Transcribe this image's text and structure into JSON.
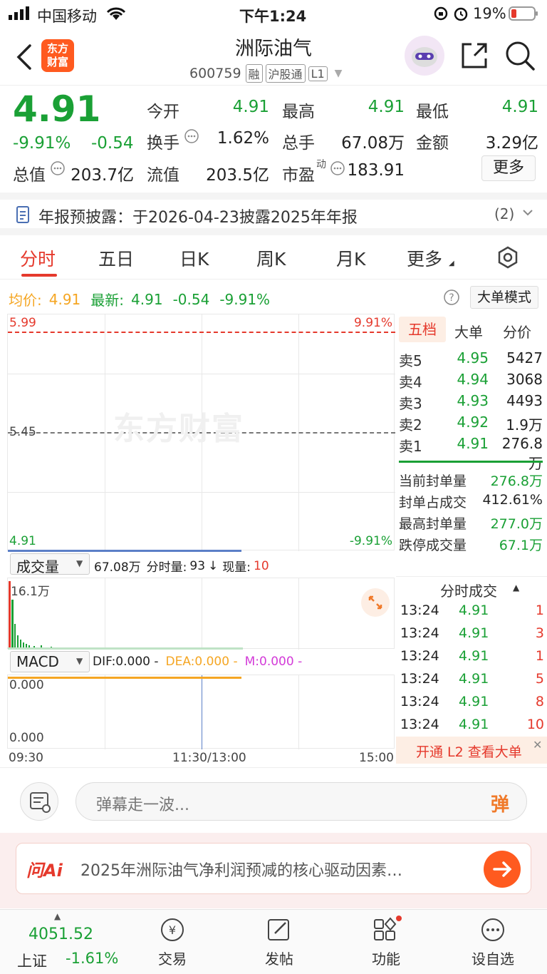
{
  "status_bar": {
    "carrier": "中国移动",
    "time": "下午1:24",
    "battery": "19%"
  },
  "header": {
    "logo_text_1": "东方",
    "logo_text_2": "财富",
    "stock_name": "洲际油气",
    "stock_code": "600759",
    "tags": [
      "融",
      "沪股通",
      "L1"
    ]
  },
  "quote": {
    "price": "4.91",
    "change_pct": "-9.91%",
    "change": "-0.54",
    "rows": [
      {
        "label": "今开",
        "value": "4.91",
        "label2": "最高",
        "value2": "4.91",
        "label3": "最低",
        "value3": "4.91"
      },
      {
        "label": "换手",
        "value": "1.62%",
        "label2": "总手",
        "value2": "67.08万",
        "label3": "金额",
        "value3": "3.29亿"
      },
      {
        "label": "总值",
        "value": "203.7亿",
        "label2": "流值",
        "value2": "203.5亿",
        "label3": "市盈",
        "value3": "183.91"
      }
    ],
    "pe_superscript": "动",
    "more_button": "更多"
  },
  "notice": {
    "text": "年报预披露：于2026-04-23披露2025年年报",
    "count": "(2)"
  },
  "tabs": [
    "分时",
    "五日",
    "日K",
    "周K",
    "月K",
    "更多"
  ],
  "summary": {
    "avg_label": "均价:",
    "avg_value": "4.91",
    "latest_label": "最新:",
    "latest_value": "4.91",
    "change": "-0.54",
    "change_pct": "-9.91%",
    "big_order_button": "大单模式"
  },
  "intraday_chart": {
    "y_top": "5.99",
    "y_mid": "5.45",
    "y_bottom": "4.91",
    "pct_top": "9.91%",
    "pct_bottom": "-9.91%",
    "watermark": "东方财富"
  },
  "volume_bar": {
    "selector": "成交量",
    "total": "67.08万",
    "minute_label": "分时量:",
    "minute_value": "93",
    "arrow": "↓",
    "current_label": "现量:",
    "current_value": "10",
    "max_label": "16.1万"
  },
  "macd": {
    "selector": "MACD",
    "dif": "DIF:0.000 -",
    "dea": "DEA:0.000 -",
    "m": "M:0.000 -",
    "y_top": "0.000",
    "y_bottom": "0.000"
  },
  "time_axis": {
    "start": "09:30",
    "mid": "11:30/13:00",
    "end": "15:00"
  },
  "order_book": {
    "tabs": [
      "五档",
      "大单",
      "分价"
    ],
    "asks": [
      {
        "label": "卖5",
        "price": "4.95",
        "vol": "5427"
      },
      {
        "label": "卖4",
        "price": "4.94",
        "vol": "3068"
      },
      {
        "label": "卖3",
        "price": "4.93",
        "vol": "4493"
      },
      {
        "label": "卖2",
        "price": "4.92",
        "vol": "1.9万"
      },
      {
        "label": "卖1",
        "price": "4.91",
        "vol": "276.8万"
      }
    ],
    "seal": [
      {
        "label": "当前封单量",
        "value": "276.8万"
      },
      {
        "label": "封单占成交",
        "value": "412.61%"
      },
      {
        "label": "最高封单量",
        "value": "277.0万"
      },
      {
        "label": "跌停成交量",
        "value": "67.1万"
      }
    ]
  },
  "ticks": {
    "title": "分时成交",
    "rows": [
      {
        "time": "13:24",
        "price": "4.91",
        "vol": "1"
      },
      {
        "time": "13:24",
        "price": "4.91",
        "vol": "3"
      },
      {
        "time": "13:24",
        "price": "4.91",
        "vol": "1"
      },
      {
        "time": "13:24",
        "price": "4.91",
        "vol": "5"
      },
      {
        "time": "13:24",
        "price": "4.91",
        "vol": "8"
      },
      {
        "time": "13:24",
        "price": "4.91",
        "vol": "10"
      }
    ],
    "promo": "开通 L2 查看大单"
  },
  "danmaku": {
    "placeholder": "弹幕走一波...",
    "send_icon": "弹"
  },
  "ai": {
    "logo": "问Ai",
    "text": "2025年洲际油气净利润预减的核心驱动因素…"
  },
  "bottom_nav": {
    "index_value": "4051.52",
    "index_name": "上证",
    "index_change": "-1.61%",
    "items": [
      "交易",
      "发帖",
      "功能",
      "设自选"
    ]
  },
  "colors": {
    "up": "#e5392c",
    "down": "#1aa035",
    "accent": "#ff6a00"
  }
}
